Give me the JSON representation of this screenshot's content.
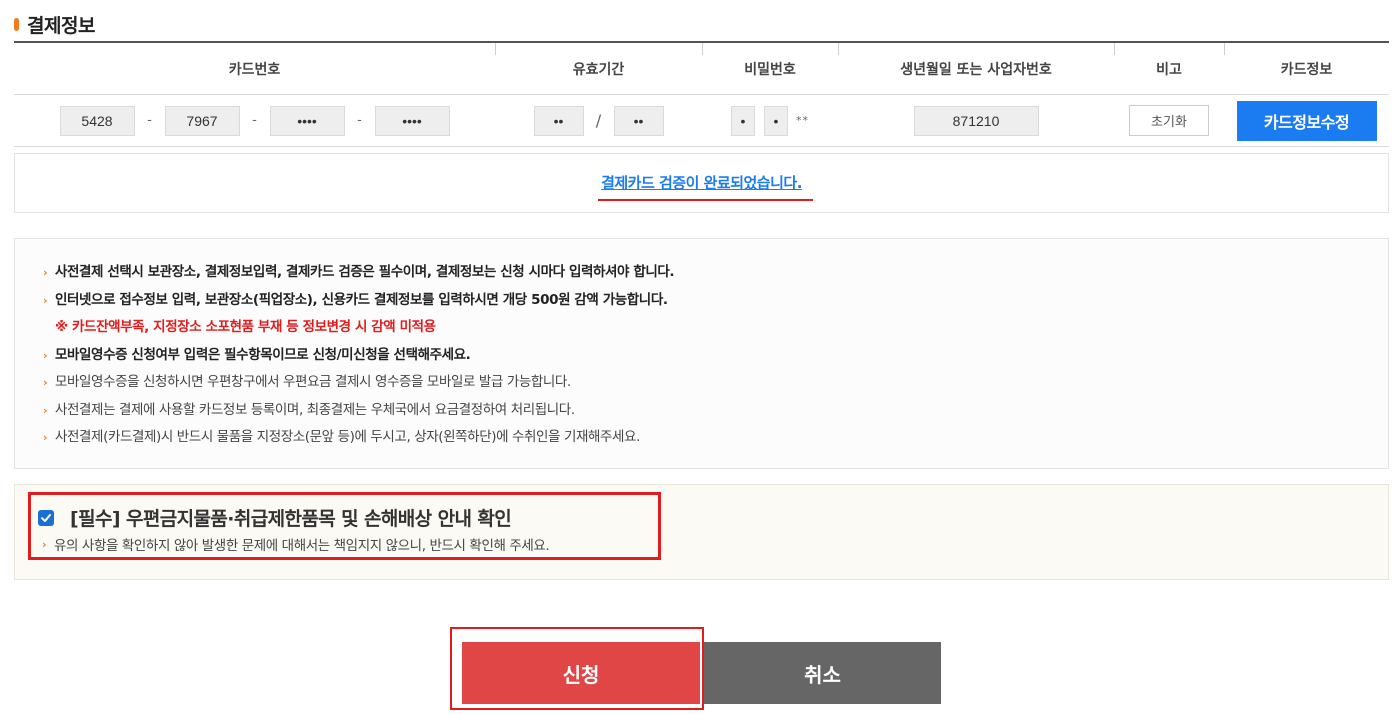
{
  "section": {
    "title": "결제정보"
  },
  "table": {
    "headers": {
      "card_number": "카드번호",
      "expiry": "유효기간",
      "password": "비밀번호",
      "birth_or_biz": "생년월일 또는 사업자번호",
      "note": "비고",
      "card_info": "카드정보"
    },
    "card_number": {
      "part1": "5428",
      "part2": "7967",
      "part3": "••••",
      "part4": "••••",
      "separator": "-"
    },
    "expiry": {
      "month": "••",
      "year": "••",
      "separator": "/"
    },
    "password": {
      "digit1": "•",
      "digit2": "•",
      "masked_suffix": "**"
    },
    "birth_or_biz": {
      "value": "871210"
    },
    "reset_label": "초기화",
    "edit_label": "카드정보수정"
  },
  "verify": {
    "message": "결제카드 검증이 완료되었습니다."
  },
  "notices": [
    {
      "text": "사전결제 선택시 보관장소, 결제정보입력, 결제카드 검증은 필수이며, 결제정보는 신청 시마다 입력하셔야 합니다."
    },
    {
      "text": "인터넷으로 접수정보 입력, 보관장소(픽업장소), 신용카드 결제정보를 입력하시면 개당 500원 감액 가능합니다."
    },
    {
      "text": "※ 카드잔액부족, 지정장소 소포현품 부재 등 정보변경 시 감액 미적용"
    },
    {
      "text": "모바일영수증 신청여부 입력은 필수항목이므로 신청/미신청을 선택해주세요."
    },
    {
      "text": "모바일영수증을 신청하시면 우편창구에서 우편요금 결제시 영수증을 모바일로 발급 가능합니다."
    },
    {
      "text": "사전결제는 결제에 사용할 카드정보 등록이며, 최종결제는 우체국에서 요금결정하여 처리됩니다."
    },
    {
      "text": "사전결제(카드결제)시 반드시 물품을 지정장소(문앞 등)에 두시고, 상자(왼쪽하단)에 수취인을 기재해주세요."
    }
  ],
  "consent": {
    "checked": true,
    "title": "[필수] 우편금지물품·취급제한품목 및 손해배상 안내 확인",
    "description": "유의 사항을 확인하지 않아 발생한 문제에 대해서는 책임지지 않으니, 반드시 확인해 주세요."
  },
  "buttons": {
    "apply": "신청",
    "cancel": "취소"
  },
  "colors": {
    "accent_blue": "#1a7cf0",
    "highlight_red": "#e21c1c",
    "apply_red": "#e04646",
    "cancel_gray": "#666666",
    "bullet_orange": "#f07c1e"
  }
}
